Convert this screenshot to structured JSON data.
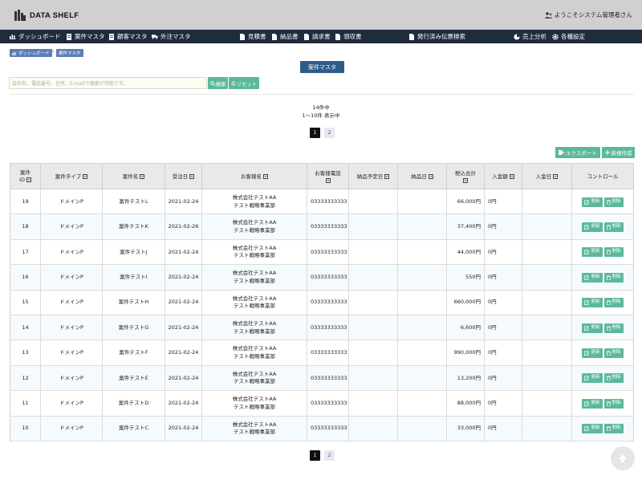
{
  "app": {
    "logo_text": "DATA SHELF",
    "welcome": "ようこそシステム管理者さん"
  },
  "nav": {
    "left": [
      {
        "label": "ダッシュボード",
        "icon": "chart-icon"
      },
      {
        "label": "案件マスタ",
        "icon": "document-icon"
      },
      {
        "label": "顧客マスタ",
        "icon": "document-icon"
      },
      {
        "label": "外注マスタ",
        "icon": "truck-icon"
      }
    ],
    "docs": [
      {
        "label": "見積書",
        "icon": "file-icon"
      },
      {
        "label": "納品書",
        "icon": "file-icon"
      },
      {
        "label": "請求書",
        "icon": "file-icon"
      },
      {
        "label": "領収書",
        "icon": "file-icon"
      }
    ],
    "issued": {
      "label": "発行済み伝票検索",
      "icon": "file-icon"
    },
    "right": [
      {
        "label": "売上分析",
        "icon": "pie-icon"
      },
      {
        "label": "各種設定",
        "icon": "gear-icon"
      }
    ]
  },
  "breadcrumb": [
    "ダッシュボード",
    "案件マスタ"
  ],
  "page_title": "案件マスタ",
  "search": {
    "placeholder": "会社名、電話番号、住所、E-mailで検索が可能です。",
    "search_label": "検索",
    "reset_label": "リセット"
  },
  "counts": {
    "total": "14件中",
    "range": "1〜10件 表示中"
  },
  "pagination": {
    "pages": [
      "1",
      "2"
    ],
    "current": "1"
  },
  "actions": {
    "export_label": "エクスポート",
    "new_label": "新規作成"
  },
  "table": {
    "headers": [
      "案件\nID",
      "案件タイプ",
      "案件名",
      "受注日",
      "お客様名",
      "お客様電話",
      "納品予定日",
      "納品日",
      "税込合計",
      "入金額",
      "入金日",
      "コントロール"
    ],
    "rows": [
      {
        "id": "19",
        "type": "ドメインP",
        "name": "案件テストL",
        "order_date": "2021-02-24",
        "customer": "株式会社テストAA\nテスト戦略事業部",
        "phone": "03333333333",
        "due": "",
        "delivered": "",
        "total": "66,000円",
        "paid": "0円",
        "paid_date": ""
      },
      {
        "id": "18",
        "type": "ドメインP",
        "name": "案件テストK",
        "order_date": "2021-02-26",
        "customer": "株式会社テストAA\nテスト戦略事業部",
        "phone": "03333333333",
        "due": "",
        "delivered": "",
        "total": "37,400円",
        "paid": "0円",
        "paid_date": ""
      },
      {
        "id": "17",
        "type": "ドメインP",
        "name": "案件テストJ",
        "order_date": "2021-02-24",
        "customer": "株式会社テストAA\nテスト戦略事業部",
        "phone": "03333333333",
        "due": "",
        "delivered": "",
        "total": "44,000円",
        "paid": "0円",
        "paid_date": ""
      },
      {
        "id": "16",
        "type": "ドメインP",
        "name": "案件テストI",
        "order_date": "2021-02-24",
        "customer": "株式会社テストAA\nテスト戦略事業部",
        "phone": "03333333333",
        "due": "",
        "delivered": "",
        "total": "550円",
        "paid": "0円",
        "paid_date": ""
      },
      {
        "id": "15",
        "type": "ドメインP",
        "name": "案件テストH",
        "order_date": "2021-02-24",
        "customer": "株式会社テストAA\nテスト戦略事業部",
        "phone": "03333333333",
        "due": "",
        "delivered": "",
        "total": "660,000円",
        "paid": "0円",
        "paid_date": ""
      },
      {
        "id": "14",
        "type": "ドメインP",
        "name": "案件テストG",
        "order_date": "2021-02-24",
        "customer": "株式会社テストAA\nテスト戦略事業部",
        "phone": "03333333333",
        "due": "",
        "delivered": "",
        "total": "6,600円",
        "paid": "0円",
        "paid_date": ""
      },
      {
        "id": "13",
        "type": "ドメインP",
        "name": "案件テストF",
        "order_date": "2021-02-24",
        "customer": "株式会社テストAA\nテスト戦略事業部",
        "phone": "03333333333",
        "due": "",
        "delivered": "",
        "total": "990,000円",
        "paid": "0円",
        "paid_date": ""
      },
      {
        "id": "12",
        "type": "ドメインP",
        "name": "案件テストE",
        "order_date": "2021-02-24",
        "customer": "株式会社テストAA\nテスト戦略事業部",
        "phone": "03333333333",
        "due": "",
        "delivered": "",
        "total": "13,200円",
        "paid": "0円",
        "paid_date": ""
      },
      {
        "id": "11",
        "type": "ドメインP",
        "name": "案件テストD",
        "order_date": "2021-02-24",
        "customer": "株式会社テストAA\nテスト戦略事業部",
        "phone": "03333333333",
        "due": "",
        "delivered": "",
        "total": "88,000円",
        "paid": "0円",
        "paid_date": ""
      },
      {
        "id": "10",
        "type": "ドメインP",
        "name": "案件テストC",
        "order_date": "2021-02-24",
        "customer": "株式会社テストAA\nテスト戦略事業部",
        "phone": "03333333333",
        "due": "",
        "delivered": "",
        "total": "33,000円",
        "paid": "0円",
        "paid_date": ""
      }
    ],
    "update_label": "更新",
    "delete_label": "削除"
  },
  "colors": {
    "accent": "#5cb89c",
    "navbar": "#1f2c3d",
    "header": "#d0d0d0",
    "title": "#2e5c8a"
  }
}
